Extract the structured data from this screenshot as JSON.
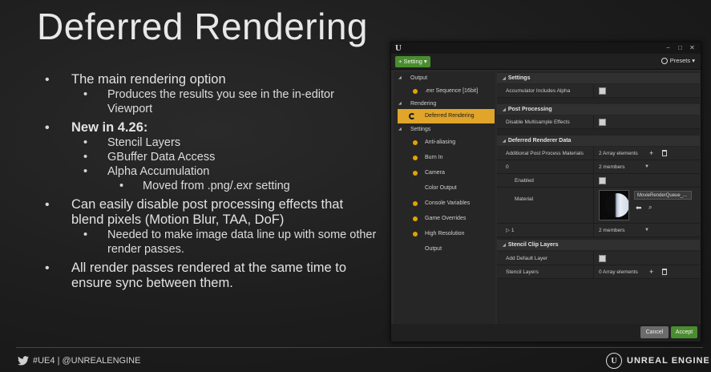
{
  "slide": {
    "title": "Deferred Rendering",
    "bullets": [
      {
        "text": "The main rendering option"
      },
      {
        "text": "Produces the results you see in the in-editor Viewport"
      },
      {
        "text": "New in 4.26:"
      },
      {
        "text": "Stencil Layers"
      },
      {
        "text": "GBuffer Data Access"
      },
      {
        "text": "Alpha Accumulation"
      },
      {
        "text": "Moved from .png/.exr setting"
      },
      {
        "text": "Can easily disable post processing effects that blend pixels (Motion Blur, TAA, DoF)"
      },
      {
        "text": "Needed to make image data line up with some other render passes."
      },
      {
        "text": "All render passes rendered at the same time to ensure sync between them."
      }
    ]
  },
  "footer": {
    "handle": "#UE4 | @UNREALENGINE",
    "brand": "UNREAL ENGINE"
  },
  "window": {
    "logo": "U",
    "controls": [
      "−",
      "□",
      "✕"
    ],
    "setting_button": "+ Setting ▾",
    "presets": "Presets ▾",
    "tree": {
      "output_cat": "Output",
      "exr": ".exr Sequence [16bit]",
      "rendering_cat": "Rendering",
      "deferred": "Deferred Rendering",
      "settings_cat": "Settings",
      "antialiasing": "Anti-aliasing",
      "burnin": "Burn In",
      "camera": "Camera",
      "color_output": "Color Output",
      "console_vars": "Console Variables",
      "game_overrides": "Game Overrides",
      "high_res": "High Resolution",
      "output": "Output"
    },
    "props": {
      "settings_hdr": "Settings",
      "accum_alpha": "Accumulator Includes Alpha",
      "pp_hdr": "Post Processing",
      "disable_ms": "Disable Multisample Effects",
      "drd_hdr": "Deferred Renderer Data",
      "add_pp": "Additional Post Process Materials",
      "add_pp_val": "2 Array elements",
      "idx0": "0",
      "idx0_val": "2 members",
      "enabled": "Enabled",
      "material": "Material",
      "material_asset": "MovieRenderQueue_...",
      "idx1": "1",
      "idx1_val": "2 members",
      "stencil_hdr": "Stencil Clip Layers",
      "add_default": "Add Default Layer",
      "stencil_layers": "Stencil Layers",
      "stencil_val": "0 Array elements"
    },
    "cancel": "Cancel",
    "accept": "Accept"
  }
}
